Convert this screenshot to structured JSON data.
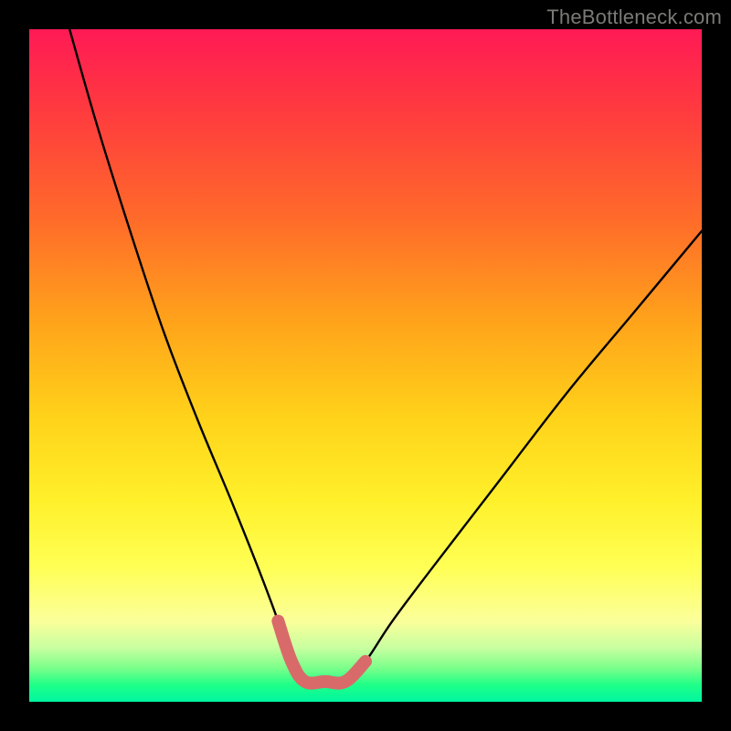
{
  "watermark": "TheBottleneck.com",
  "chart_data": {
    "type": "line",
    "title": "",
    "xlabel": "",
    "ylabel": "",
    "xlim": [
      0,
      100
    ],
    "ylim": [
      0,
      100
    ],
    "series": [
      {
        "name": "bottleneck-curve",
        "x": [
          6,
          10,
          15,
          20,
          25,
          30,
          34,
          37,
          39,
          41,
          44,
          47,
          50,
          54,
          60,
          70,
          80,
          90,
          100
        ],
        "values": [
          100,
          86,
          70,
          55,
          42,
          30,
          20,
          12,
          6,
          3,
          3,
          3,
          6,
          12,
          20,
          33,
          46,
          58,
          70
        ]
      },
      {
        "name": "optimal-band-marker",
        "x": [
          37,
          39,
          41,
          44,
          47,
          50
        ],
        "values": [
          12,
          6,
          3,
          3,
          3,
          6
        ]
      }
    ],
    "colors": {
      "curve": "#000000",
      "marker": "#d96a6a",
      "gradient_top": "#ff1a55",
      "gradient_mid": "#fff02a",
      "gradient_bottom": "#00f5a0"
    }
  }
}
